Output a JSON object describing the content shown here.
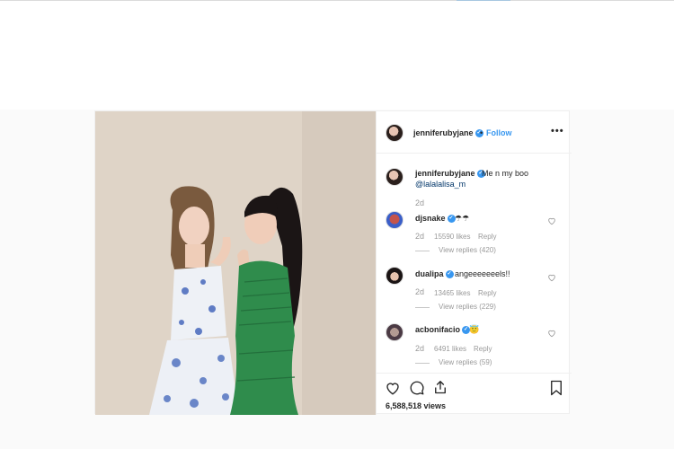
{
  "post": {
    "author": "jenniferubyjane",
    "follow_label": "Follow",
    "separator": "•",
    "more_label": "•••",
    "caption": "Me n my boo",
    "mention": "@lalalalisa_m",
    "caption_time": "2d",
    "views": "6,588,518 views"
  },
  "comments": [
    {
      "user": "djsnake",
      "text": "☂☂",
      "time": "2d",
      "likes": "15590 likes",
      "reply": "Reply",
      "view_replies": "View replies (420)"
    },
    {
      "user": "dualipa",
      "text": "angeeeeeeels!!",
      "time": "2d",
      "likes": "13465 likes",
      "reply": "Reply",
      "view_replies": "View replies (229)"
    },
    {
      "user": "acbonifacio",
      "text": "😇",
      "time": "2d",
      "likes": "6491 likes",
      "reply": "Reply",
      "view_replies": "View replies (59)"
    }
  ],
  "icons": {
    "verified": "verified-badge-icon",
    "like": "heart-icon",
    "comment": "comment-icon",
    "share": "share-icon",
    "save": "bookmark-icon"
  },
  "colors": {
    "link": "#3897f0",
    "mention": "#003569",
    "muted": "#999999",
    "border": "#efefef"
  }
}
